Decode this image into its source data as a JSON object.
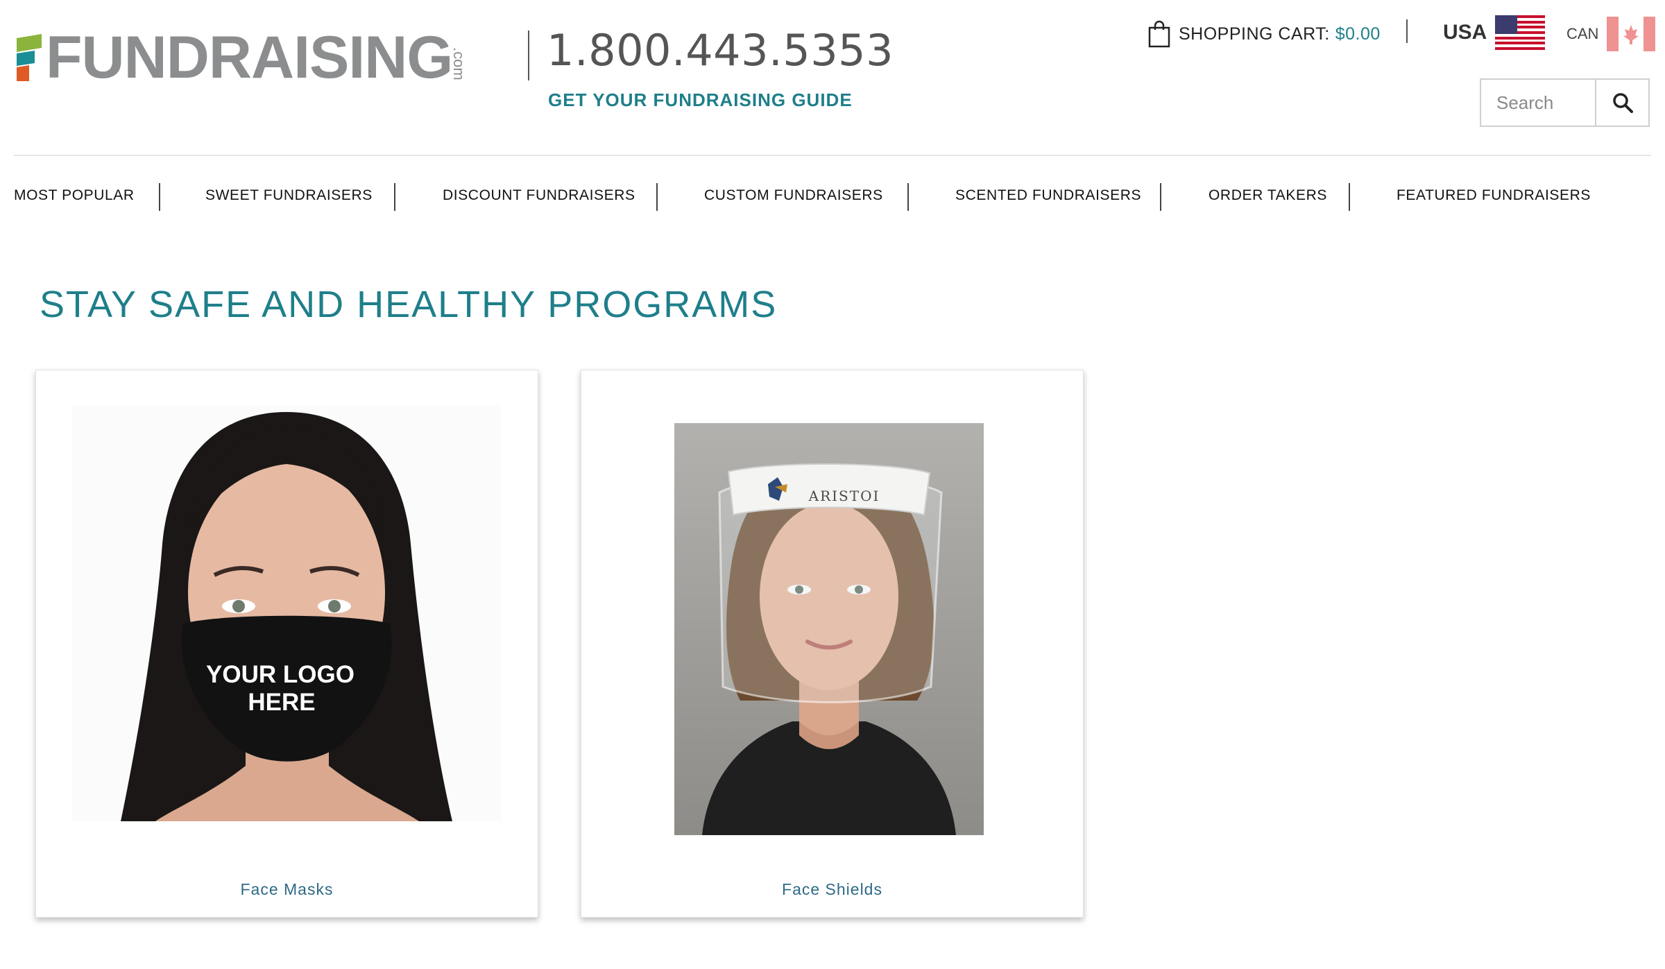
{
  "header": {
    "logo_text": "FUNDRAISING",
    "logo_suffix": ".com",
    "phone": "1.800.443.5353",
    "guide_link": "GET YOUR FUNDRAISING GUIDE",
    "cart_label": "SHOPPING CART:",
    "cart_amount": "$0.00",
    "region_usa": "USA",
    "region_can": "CAN",
    "search_placeholder": "Search",
    "icons": [
      "shopping-bag-icon",
      "usa-flag-icon",
      "canada-flag-icon",
      "search-icon"
    ]
  },
  "nav": {
    "items": [
      "MOST POPULAR",
      "SWEET FUNDRAISERS",
      "DISCOUNT FUNDRAISERS",
      "CUSTOM FUNDRAISERS",
      "SCENTED FUNDRAISERS",
      "ORDER TAKERS",
      "FEATURED FUNDRAISERS"
    ]
  },
  "main": {
    "title": "STAY SAFE AND HEALTHY PROGRAMS",
    "products": [
      {
        "label": "Face Masks",
        "image_text_line1": "YOUR LOGO",
        "image_text_line2": "HERE"
      },
      {
        "label": "Face Shields",
        "image_text": "ARISTOI"
      }
    ]
  },
  "colors": {
    "accent_teal": "#1e7f8a",
    "logo_gray": "#8b8d8f",
    "logo_green": "#8ab43c",
    "logo_orange": "#e05a26",
    "logo_teal": "#1a8e95",
    "link_blue": "#2e6a86"
  }
}
